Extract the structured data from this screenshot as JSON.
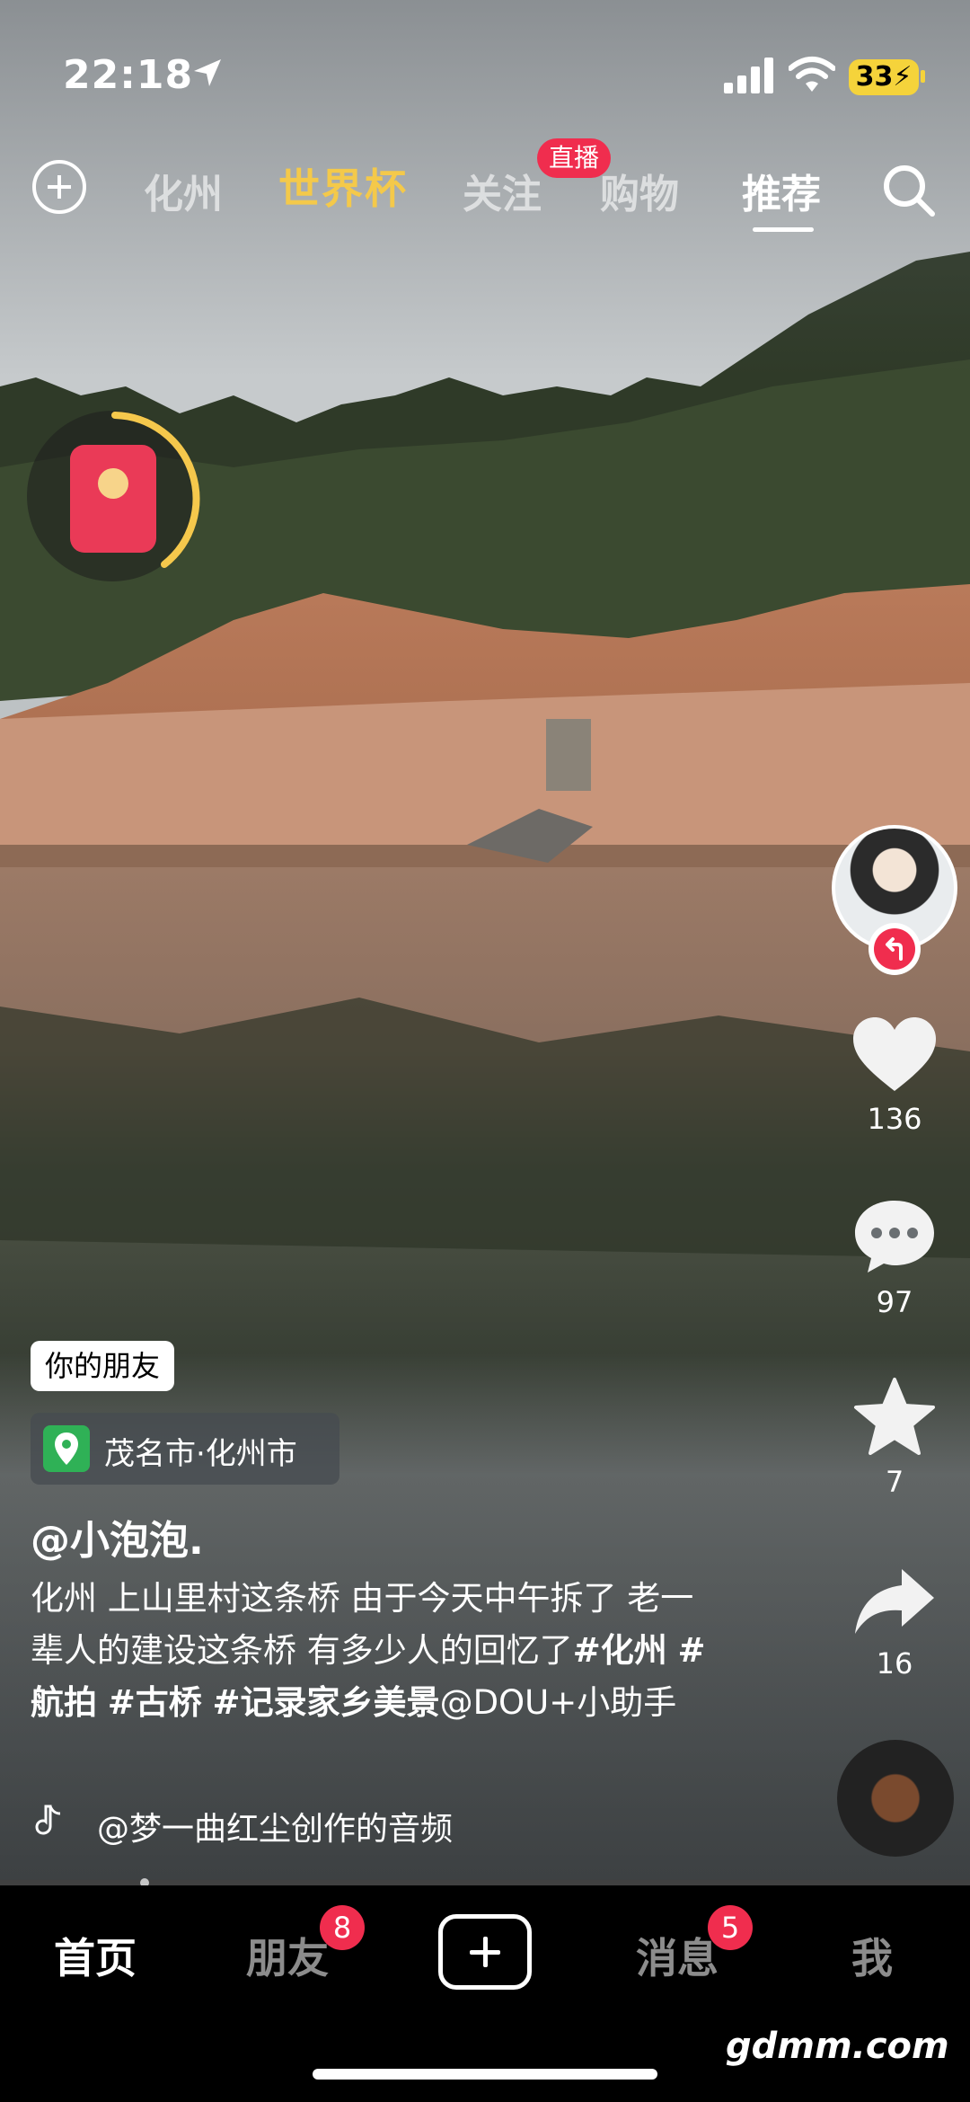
{
  "status_bar": {
    "time": "22:18",
    "battery": "33"
  },
  "top_nav": {
    "tabs": [
      "化州",
      "世界杯",
      "关注",
      "购物",
      "推荐"
    ],
    "active_tab": "推荐",
    "live_badge": "直播"
  },
  "video": {
    "friend_tag": "你的朋友",
    "location": "茂名市·化州市",
    "author": "@小泡泡.",
    "caption_text": "化州 上山里村这条桥 由于今天中午拆了 老一辈人的建设这条桥 有多少人的回忆了",
    "hashtags": [
      "#化州",
      "#航拍",
      "#古桥",
      "#记录家乡美景"
    ],
    "mention": "@DOU+小助手",
    "music": "@梦一曲红尘创作的音频"
  },
  "actions": {
    "likes": "136",
    "comments": "97",
    "favorites": "7",
    "shares": "16"
  },
  "bottom_nav": {
    "items": [
      "首页",
      "朋友",
      "消息",
      "我"
    ],
    "friends_badge": "8",
    "messages_badge": "5"
  },
  "watermark": "gdmm.com",
  "colors": {
    "accent": "#f02d4e",
    "battery": "#f5d33b",
    "location_icon": "#2fb156"
  },
  "progress": 0.15
}
